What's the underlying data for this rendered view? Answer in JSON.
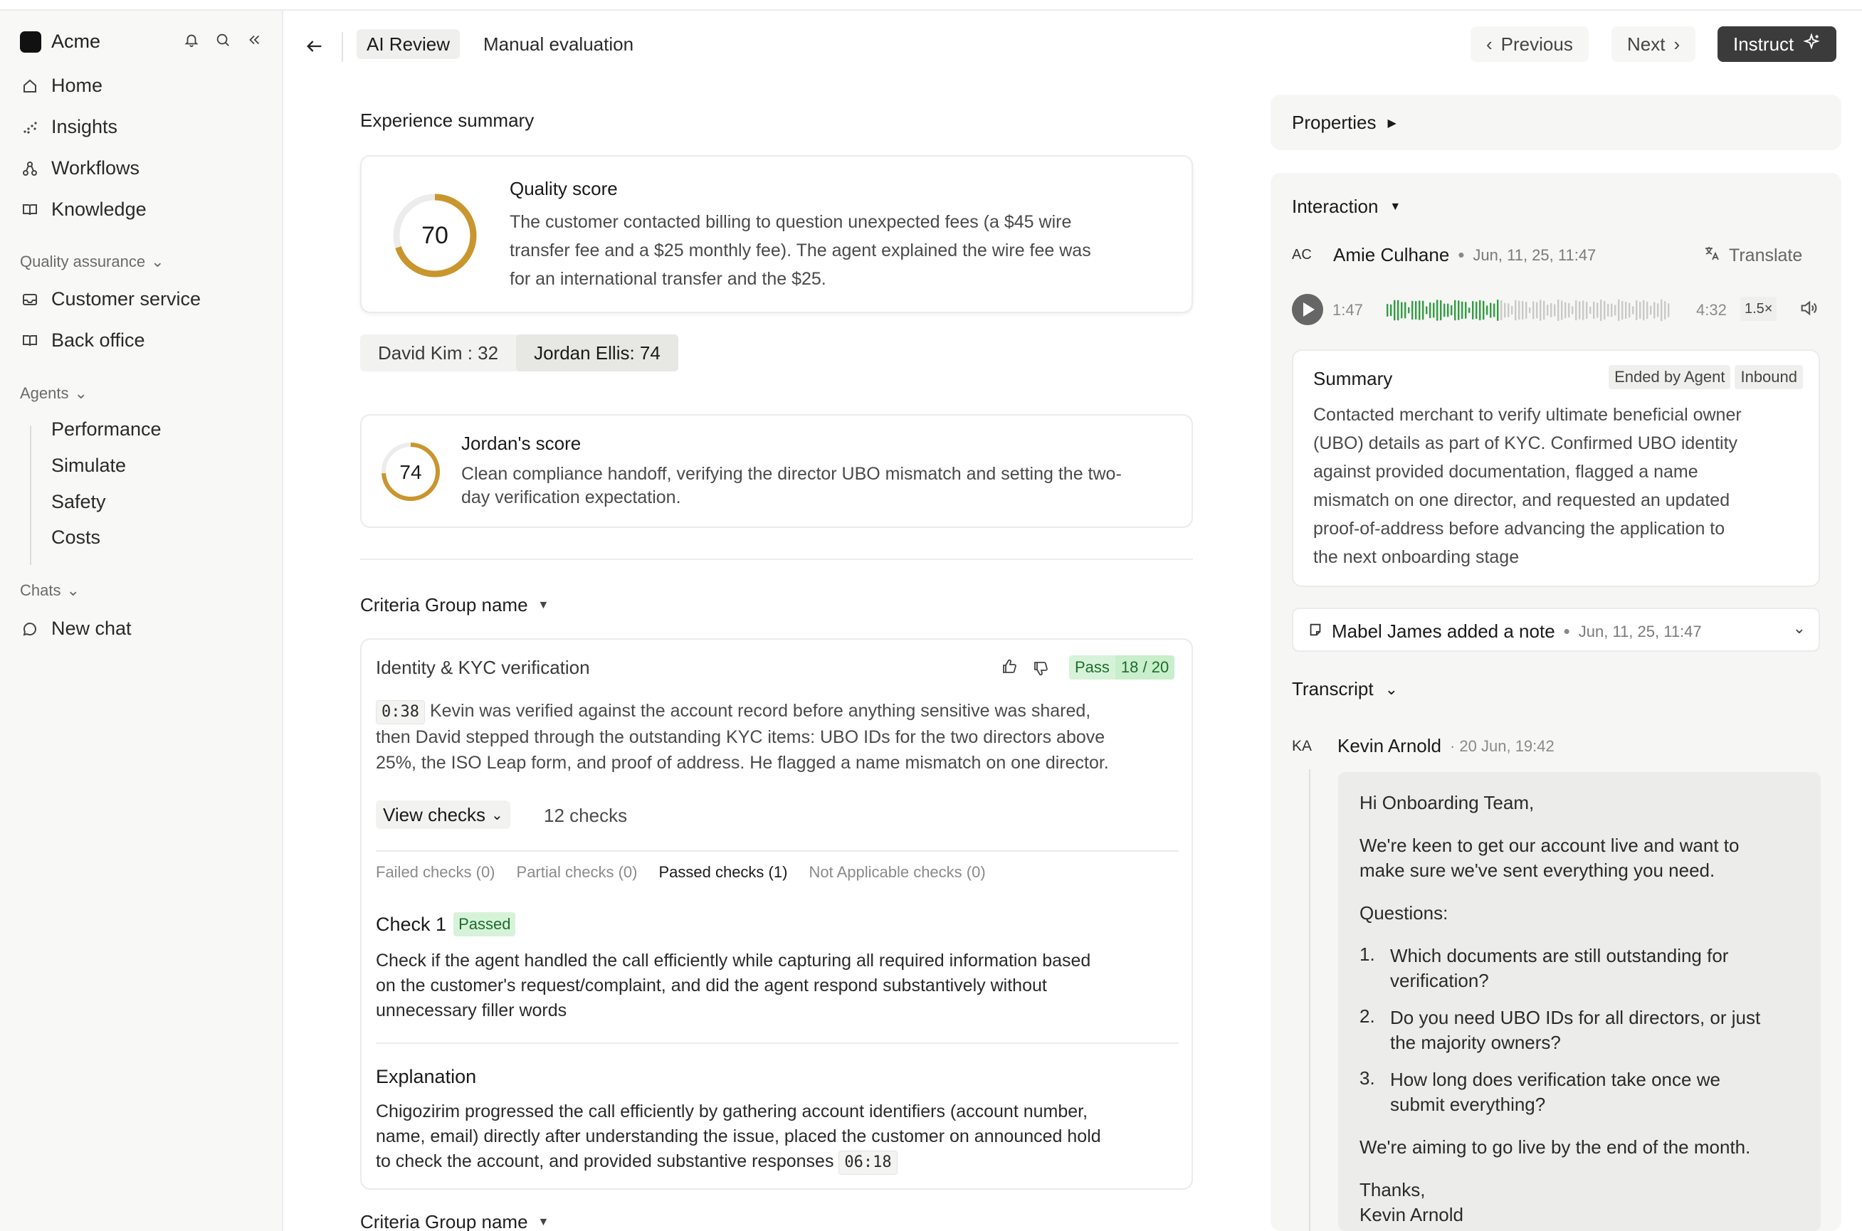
{
  "sidebar": {
    "brand": "Acme",
    "nav": [
      {
        "label": "Home",
        "icon": "home-icon"
      },
      {
        "label": "Insights",
        "icon": "insights-icon"
      },
      {
        "label": "Workflows",
        "icon": "workflows-icon"
      },
      {
        "label": "Knowledge",
        "icon": "book-icon"
      }
    ],
    "qa_label": "Quality assurance",
    "qa_items": [
      {
        "label": "Customer service",
        "icon": "inbox-icon"
      },
      {
        "label": "Back office",
        "icon": "book-icon"
      }
    ],
    "agents_label": "Agents",
    "agents_items": [
      "Performance",
      "Simulate",
      "Safety",
      "Costs"
    ],
    "chats_label": "Chats",
    "new_chat": "New chat"
  },
  "toolbar": {
    "tab_ai": "AI Review",
    "tab_manual": "Manual evaluation",
    "previous": "Previous",
    "next": "Next",
    "instruct": "Instruct"
  },
  "experience": {
    "heading": "Experience summary",
    "quality_score": 70,
    "quality_title": "Quality score",
    "quality_text_1": "The customer contacted billing to question unexpected fees (a $45 wire",
    "quality_text_2": "transfer fee and a $25 monthly fee). The agent explained the wire fee was",
    "quality_text_3": "for an international transfer and the $25.",
    "seg_a": "David Kim : 32",
    "seg_b": "Jordan Ellis: 74",
    "jordan_score": 74,
    "jordan_title": "Jordan's score",
    "jordan_text_1": "Clean compliance handoff, verifying the director UBO mismatch and setting the two-",
    "jordan_text_2": "day verification expectation."
  },
  "criteria": {
    "group_name": "Criteria Group name",
    "group_name_2": "Criteria Group name",
    "item_title": "Identity & KYC verification",
    "pass_label": "Pass",
    "pass_score": "18 / 20",
    "timecode_1": "0:38",
    "desc_1": "Kevin was verified against the account record before anything sensitive was shared,",
    "desc_2": "then David stepped through the outstanding KYC items: UBO IDs for the two directors above",
    "desc_3": "25%, the ISO Leap form, and proof of address. He flagged a name mismatch on one director.",
    "view_checks": "View checks",
    "checks_count": "12 checks",
    "tabs": [
      "Failed checks (0)",
      "Partial checks (0)",
      "Passed checks (1)",
      "Not Applicable checks (0)"
    ],
    "check_title": "Check 1",
    "check_status": "Passed",
    "check_text_1": "Check if the agent handled the call efficiently while capturing all required information based",
    "check_text_2": "on the customer's request/complaint, and did the agent respond substantively without",
    "check_text_3": "unnecessary filler words",
    "explanation_title": "Explanation",
    "expl_1": "Chigozirim progressed the call efficiently by gathering account identifiers (account number,",
    "expl_2": "name, email) directly after understanding the issue, placed the customer on announced hold",
    "expl_3": "to check the account, and provided substantive responses",
    "timecode_2": "06:18"
  },
  "right": {
    "properties": "Properties",
    "interaction": "Interaction",
    "caller_initials": "AC",
    "caller_name": "Amie Culhane",
    "caller_date": "Jun, 11, 25, 11:47",
    "translate": "Translate",
    "audio_current": "1:47",
    "audio_total": "4:32",
    "audio_speed": "1.5×",
    "summary_title": "Summary",
    "tag_ended": "Ended by Agent",
    "tag_inbound": "Inbound",
    "summary_lines": [
      "Contacted merchant to verify ultimate beneficial owner",
      "(UBO) details as part of KYC. Confirmed UBO identity",
      "against provided documentation, flagged a name",
      "mismatch on one director, and requested an updated",
      "proof-of-address before advancing the application to",
      "the next onboarding stage"
    ],
    "note_text": "Mabel James added a note",
    "note_date": "Jun, 11, 25, 11:47",
    "transcript": "Transcript",
    "msg_initials": "KA",
    "msg_author": "Kevin Arnold",
    "msg_date": "· 20 Jun, 19:42",
    "msg_greeting": "Hi Onboarding Team,",
    "msg_p1a": "We're keen to get our account live and want to",
    "msg_p1b": "make sure we've sent everything you need.",
    "msg_questions": "Questions:",
    "q1_num": "1.",
    "q1a": "Which documents are still outstanding for",
    "q1b": "verification?",
    "q2_num": "2.",
    "q2a": "Do you need UBO IDs for all directors, or just",
    "q2b": "the majority owners?",
    "q3_num": "3.",
    "q3a": "How long does verification take once we",
    "q3b": "submit everything?",
    "msg_p2": "We're aiming to go live by the end of the month.",
    "msg_thanks": "Thanks,",
    "msg_sign": "Kevin Arnold"
  },
  "colors": {
    "ring_gold": "#c9962e",
    "ring_track": "#ececec",
    "pass_green": "#d6f3d9",
    "wave_green": "#2f9e3f",
    "wave_gray": "#c9c9c9"
  }
}
